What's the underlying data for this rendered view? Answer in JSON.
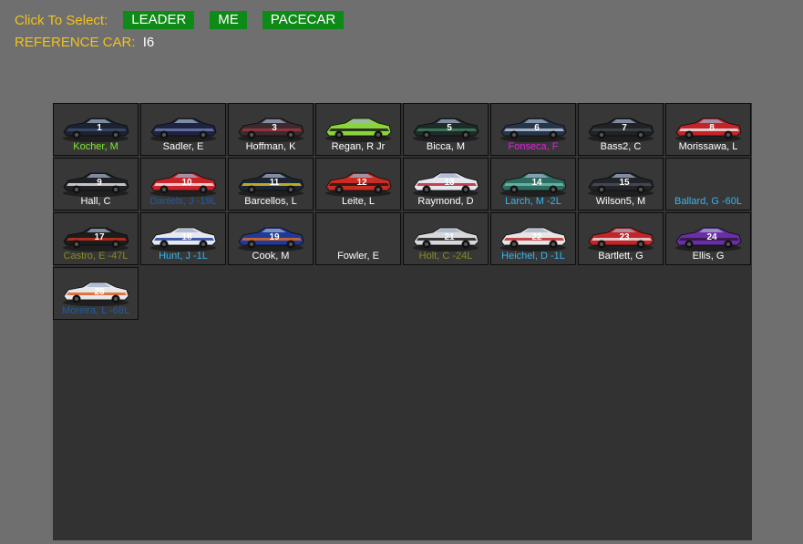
{
  "header": {
    "click_label": "Click To Select:",
    "buttons": [
      "LEADER",
      "ME",
      "PACECAR"
    ],
    "reference_label": "REFERENCE CAR:",
    "reference_value": "I6"
  },
  "colors": {
    "background": "#6f6f6f",
    "panel": "#323232",
    "yellow": "#f2c21b",
    "button_green": "#0e8a17"
  },
  "cars": [
    {
      "label": "Kocher, M",
      "color": "#7ee82e",
      "car": "#1d2230",
      "accent": "#3a4c70",
      "number": "1"
    },
    {
      "label": "Sadler, E",
      "color": "#ffffff",
      "car": "#1e2440",
      "accent": "#6c7bb0",
      "number": ""
    },
    {
      "label": "Hoffman, K",
      "color": "#ffffff",
      "car": "#3b2a2e",
      "accent": "#a03540",
      "number": "3"
    },
    {
      "label": "Regan, R Jr",
      "color": "#ffffff",
      "car": "#8ad63a",
      "accent": "#1b1b1b",
      "number": ""
    },
    {
      "label": "Bicca, M",
      "color": "#ffffff",
      "car": "#1f2b28",
      "accent": "#3f7f60",
      "number": "5"
    },
    {
      "label": "Fonseca, F",
      "color": "#e21ee2",
      "car": "#26354a",
      "accent": "#b8c7d8",
      "number": "6"
    },
    {
      "label": "Bass2, C",
      "color": "#ffffff",
      "car": "#202226",
      "accent": "#40444c",
      "number": "7"
    },
    {
      "label": "Morissawa, L",
      "color": "#ffffff",
      "car": "#c42428",
      "accent": "#e8e8e8",
      "number": "8"
    },
    {
      "label": "Hall, C",
      "color": "#ffffff",
      "car": "#202124",
      "accent": "#e0e0e0",
      "number": "9"
    },
    {
      "label": "Daniels, J -19L",
      "color": "#1e5ca8",
      "car": "#c9242a",
      "accent": "#f0e6e6",
      "number": "10"
    },
    {
      "label": "Barcellos, L",
      "color": "#ffffff",
      "car": "#1d2432",
      "accent": "#d8c21e",
      "number": "11"
    },
    {
      "label": "Leite, L",
      "color": "#ffffff",
      "car": "#c82c22",
      "accent": "#1a1a1a",
      "number": "12"
    },
    {
      "label": "Raymond, D",
      "color": "#ffffff",
      "car": "#e6e6ee",
      "accent": "#c02230",
      "number": "13"
    },
    {
      "label": "Larch, M -2L",
      "color": "#35b5f0",
      "car": "#2e6b60",
      "accent": "#6ac0a8",
      "number": "14"
    },
    {
      "label": "Wilson5, M",
      "color": "#ffffff",
      "car": "#22242a",
      "accent": "#4a4e58",
      "number": "15"
    },
    {
      "label": "Ballard, G -60L",
      "color": "#35b5f0",
      "car": "",
      "accent": "",
      "number": ""
    },
    {
      "label": "Castro, E -47L",
      "color": "#8a8a1e",
      "car": "#1c1c1c",
      "accent": "#c83020",
      "number": "17"
    },
    {
      "label": "Hunt, J -1L",
      "color": "#35b5f0",
      "car": "#e8e8f0",
      "accent": "#1e3f9a",
      "number": "18"
    },
    {
      "label": "Cook, M",
      "color": "#ffffff",
      "car": "#1e3a9a",
      "accent": "#e06a1e",
      "number": "19"
    },
    {
      "label": "Fowler, E",
      "color": "#ffffff",
      "car": "",
      "accent": "",
      "number": ""
    },
    {
      "label": "Holt, C -24L",
      "color": "#8a8a1e",
      "car": "#d8d8dc",
      "accent": "#1a1a1a",
      "number": "21"
    },
    {
      "label": "Heichel, D -1L",
      "color": "#35b5f0",
      "car": "#e6e6e6",
      "accent": "#c02828",
      "number": "22"
    },
    {
      "label": "Bartlett, G",
      "color": "#ffffff",
      "car": "#c42428",
      "accent": "#e0e0e0",
      "number": "23"
    },
    {
      "label": "Ellis, G",
      "color": "#ffffff",
      "car": "#6a2ea8",
      "accent": "#2a1a3a",
      "number": "24"
    },
    {
      "label": "Moreira, L -68L",
      "color": "#1e5ca8",
      "car": "#e8e8ea",
      "accent": "#e0601e",
      "number": "25"
    }
  ]
}
